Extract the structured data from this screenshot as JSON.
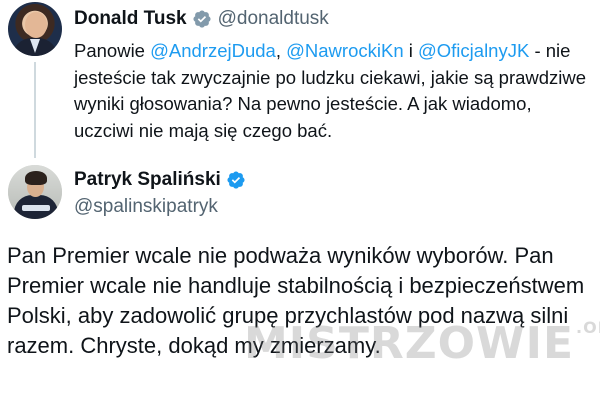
{
  "tweet1": {
    "author_name": "Donald Tusk",
    "handle": "@donaldtusk",
    "text_prefix": "Panowie ",
    "mention1": "@AndrzejDuda",
    "sep1": ", ",
    "mention2": "@NawrockiKn",
    "sep2": " i ",
    "mention3": "@OficjalnyJK",
    "text_suffix": " - nie jesteście tak zwyczajnie po ludzku ciekawi, jakie są prawdziwe wyniki głosowania? Na pewno jesteście. A jak wiadomo, uczciwi nie mają się czego bać."
  },
  "tweet2": {
    "author_name": "Patryk Spaliński",
    "handle": "@spalinskipatryk",
    "text": "Pan Premier wcale nie podważa wyników wyborów. Pan Premier wcale nie handluje stabilnością i bezpieczeństwem Polski, aby zadowolić grupę przychlastów pod nazwą silni razem. Chryste, dokąd my zmierzamy."
  },
  "watermark": {
    "text": "MISTRZOWIE",
    "suffix": ".ORG"
  },
  "colors": {
    "link": "#1d9bf0",
    "verified": "#1d9bf0",
    "handle": "#536471",
    "text": "#0f1419"
  }
}
